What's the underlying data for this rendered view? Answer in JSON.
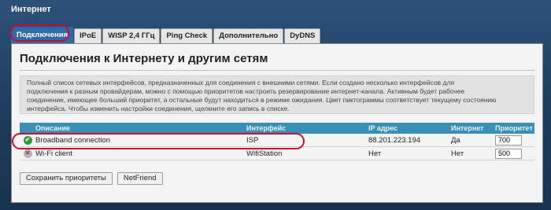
{
  "app": {
    "title": "Интернет"
  },
  "tabs": [
    {
      "label": "Подключения",
      "active": true
    },
    {
      "label": "IPoE"
    },
    {
      "label": "WISP 2,4 ГГц"
    },
    {
      "label": "Ping Check"
    },
    {
      "label": "Дополнительно"
    },
    {
      "label": "DyDNS"
    }
  ],
  "panel": {
    "title": "Подключения к Интернету и другим сетям",
    "description_lines": [
      "Полный список сетевых интерфейсов, предназначенных для соединения с внешними сетями. Если создано несколько интерфейсов для",
      "подключения к разным провайдерам, можно с помощью приоритетов настроить резервирование интернет-канала. Активным будет рабочее",
      "соединение, имеющее больший приоритет, а остальные будут находиться в режиме ожидания. Цвет пиктограммы соответствует текущему состоянию",
      "интерфейса. Чтобы изменить настройки соединения, щелкните его запись в списке."
    ]
  },
  "table": {
    "headers": {
      "name": "Описание",
      "interface": "Интерфейс",
      "ip": "IP адрес",
      "internet": "Интернет",
      "priority": "Приоритет"
    },
    "rows": [
      {
        "status_icon": "check-circle-icon",
        "name": "Broadband connection",
        "interface": "ISP",
        "ip": "88.201.223.194",
        "internet": "Да",
        "priority": "700"
      },
      {
        "status_icon": "x-circle-icon",
        "name": "Wi-Fi client",
        "interface": "WifiStation",
        "ip": "Нет",
        "internet": "Нет",
        "priority": "500"
      }
    ]
  },
  "buttons": {
    "save": "Сохранить приоритеты",
    "netfriend": "NetFriend"
  },
  "colors": {
    "highlight": "#c8102e",
    "header": "#3a8fb7",
    "active_tab": "#2f6aa6",
    "status_ok": "#2e9a3a"
  }
}
